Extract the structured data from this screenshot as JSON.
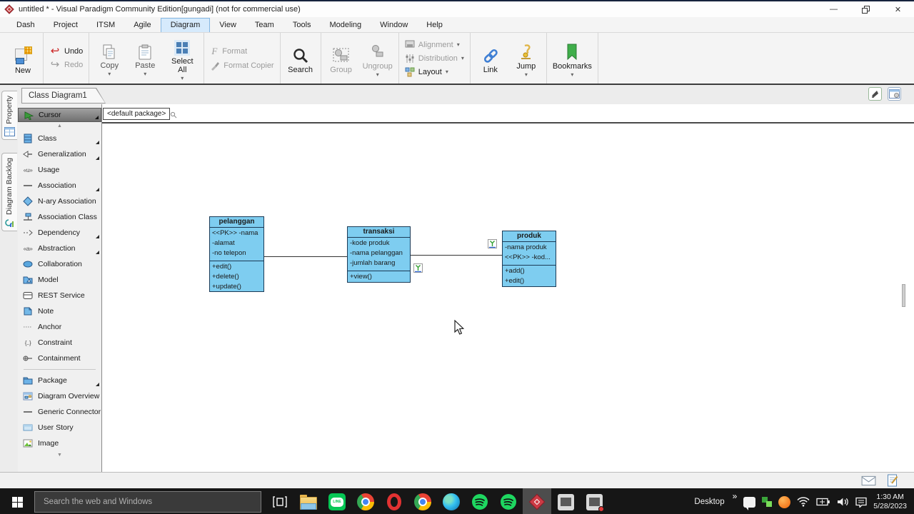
{
  "app": {
    "title": "untitled * - Visual Paradigm Community Edition[gungadi] (not for commercial use)"
  },
  "icons": {
    "chevron_down": "▾",
    "scroll_up": "▲",
    "scroll_down": "▼",
    "minimize": "—",
    "close": "✕",
    "undo_arrow": "↩",
    "redo_arrow": "↪",
    "format_f": "F",
    "usage_glyph": "«u»",
    "abstraction_glyph": "«a»",
    "constraint_glyph": "{..}",
    "tray_chevron": "»"
  },
  "menubar": {
    "active": "Diagram",
    "items": [
      {
        "label": "Dash"
      },
      {
        "label": "Project"
      },
      {
        "label": "ITSM"
      },
      {
        "label": "Agile"
      },
      {
        "label": "Diagram"
      },
      {
        "label": "View"
      },
      {
        "label": "Team"
      },
      {
        "label": "Tools"
      },
      {
        "label": "Modeling"
      },
      {
        "label": "Window"
      },
      {
        "label": "Help"
      }
    ]
  },
  "ribbon": {
    "new_label": "New",
    "undo_label": "Undo",
    "redo_label": "Redo",
    "copy_label": "Copy",
    "paste_label": "Paste",
    "select_all_label": "Select All",
    "format_label": "Format",
    "format_copier_label": "Format Copier",
    "search_label": "Search",
    "group_label": "Group",
    "ungroup_label": "Ungroup",
    "alignment_label": "Alignment",
    "distribution_label": "Distribution",
    "layout_label": "Layout",
    "link_label": "Link",
    "jump_label": "Jump",
    "bookmarks_label": "Bookmarks"
  },
  "workspace": {
    "diagram_tab": "Class Diagram1",
    "breadcrumb": "<default package>",
    "side_tabs": [
      {
        "label": "Property"
      },
      {
        "label": "Diagram Backlog"
      }
    ]
  },
  "palette": {
    "cursor_label": "Cursor",
    "items": [
      {
        "label": "Class",
        "flyout": true
      },
      {
        "label": "Generalization",
        "flyout": true
      },
      {
        "label": "Usage",
        "flyout": false
      },
      {
        "label": "Association",
        "flyout": true
      },
      {
        "label": "N-ary Association",
        "flyout": false
      },
      {
        "label": "Association Class",
        "flyout": false
      },
      {
        "label": "Dependency",
        "flyout": true
      },
      {
        "label": "Abstraction",
        "flyout": true
      },
      {
        "label": "Collaboration",
        "flyout": false
      },
      {
        "label": "Model",
        "flyout": false
      },
      {
        "label": "REST Service",
        "flyout": false
      },
      {
        "label": "Note",
        "flyout": false
      },
      {
        "label": "Anchor",
        "flyout": false
      },
      {
        "label": "Constraint",
        "flyout": false
      },
      {
        "label": "Containment",
        "flyout": false
      },
      {
        "label": "Package",
        "flyout": true
      },
      {
        "label": "Diagram Overview",
        "flyout": false
      },
      {
        "label": "Generic Connector",
        "flyout": false
      },
      {
        "label": "User Story",
        "flyout": false
      },
      {
        "label": "Image",
        "flyout": false
      }
    ]
  },
  "diagram": {
    "fill_color": "#7ecdf0",
    "border_color": "#1c3b57",
    "classes": [
      {
        "name": "pelanggan",
        "attributes": [
          "<<PK>> -nama",
          "-alamat",
          "-no telepon"
        ],
        "methods": [
          "+edit()",
          "+delete()",
          "+update()"
        ]
      },
      {
        "name": "transaksi",
        "attributes": [
          "-kode produk",
          "-nama pelanggan",
          "-jumlah barang"
        ],
        "methods": [
          "+view()"
        ]
      },
      {
        "name": "produk",
        "attributes": [
          "-nama produk",
          "<<PK>> -kod..."
        ],
        "methods": [
          "+add()",
          "+edit()"
        ]
      }
    ]
  },
  "taskbar": {
    "search_placeholder": "Search the web and Windows",
    "line_label": "LINE",
    "desktop_label": "Desktop",
    "apps": [
      {
        "name": "file-explorer",
        "running": true
      },
      {
        "name": "line",
        "running": false
      },
      {
        "name": "chrome",
        "running": false
      },
      {
        "name": "opera",
        "running": false
      },
      {
        "name": "chrome-2",
        "running": true
      },
      {
        "name": "edge",
        "running": false
      },
      {
        "name": "spotify",
        "running": false
      },
      {
        "name": "spotify-2",
        "running": true
      },
      {
        "name": "visual-paradigm",
        "running": true,
        "active": true
      },
      {
        "name": "photos",
        "running": true
      },
      {
        "name": "photos-2",
        "running": true
      }
    ],
    "clock": {
      "time": "1:30 AM",
      "date": "5/28/2023"
    }
  }
}
